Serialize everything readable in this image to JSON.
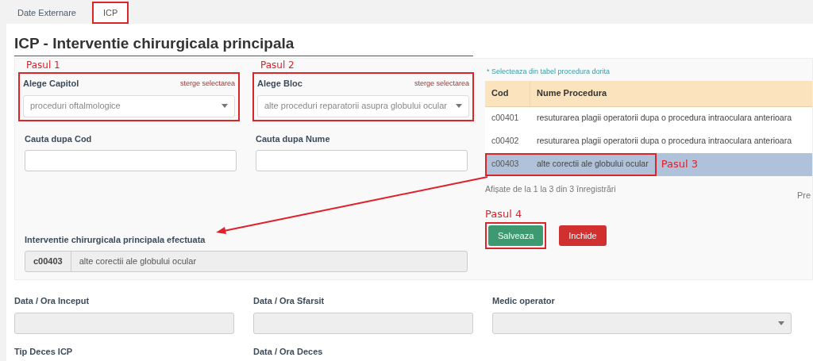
{
  "tabs": [
    {
      "label": "Date Externare",
      "selected": false,
      "annotated": false
    },
    {
      "label": "ICP",
      "selected": true,
      "annotated": true
    }
  ],
  "title": "ICP - Interventie chirurgicala principala",
  "selectors": [
    {
      "step": "Pasul 1",
      "label": "Alege Capitol",
      "clear_link": "sterge selectarea",
      "value": "proceduri oftalmologice",
      "annotated": true
    },
    {
      "step": "Pasul 2",
      "label": "Alege Bloc",
      "clear_link": "sterge selectarea",
      "value": "alte proceduri reparatorii asupra globului ocular",
      "annotated": true
    }
  ],
  "search_fields": [
    {
      "label": "Cauta dupa Cod"
    },
    {
      "label": "Cauta dupa Nume"
    }
  ],
  "result": {
    "label": "Interventie chirurgicala principala efectuata",
    "code": "c00403",
    "name": "alte corectii ale globului ocular"
  },
  "procedure_table": {
    "note": "* Selecteaza din tabel procedura dorita",
    "columns": [
      "Cod",
      "Nume Procedura"
    ],
    "rows": [
      {
        "code": "c00401",
        "name": "resuturarea plagii operatorii dupa o procedura intraoculara anterioara",
        "selected": false,
        "annotated": false
      },
      {
        "code": "c00402",
        "name": "resuturarea plagii operatorii dupa o procedura intraoculara anterioara",
        "selected": false,
        "annotated": false
      },
      {
        "code": "c00403",
        "name": "alte corectii ale globului ocular",
        "selected": true,
        "annotated": true,
        "step": "Pasul 3"
      }
    ],
    "info": "Afișate de la 1 la 3 din 3 înregistrări",
    "pager": "Pre"
  },
  "actions": {
    "step": "Pasul 4",
    "buttons": [
      {
        "label": "Salveaza",
        "kind": "save",
        "annotated": true
      },
      {
        "label": "Inchide",
        "kind": "close",
        "annotated": false
      }
    ]
  },
  "details": [
    {
      "label": "Data / Ora Inceput",
      "kind": "text"
    },
    {
      "label": "Data / Ora Sfarsit",
      "kind": "text"
    },
    {
      "label": "Medic operator",
      "kind": "select"
    },
    {
      "label": "Tip Deces ICP",
      "kind": "text"
    },
    {
      "label": "Data / Ora Deces",
      "kind": "text"
    }
  ]
}
